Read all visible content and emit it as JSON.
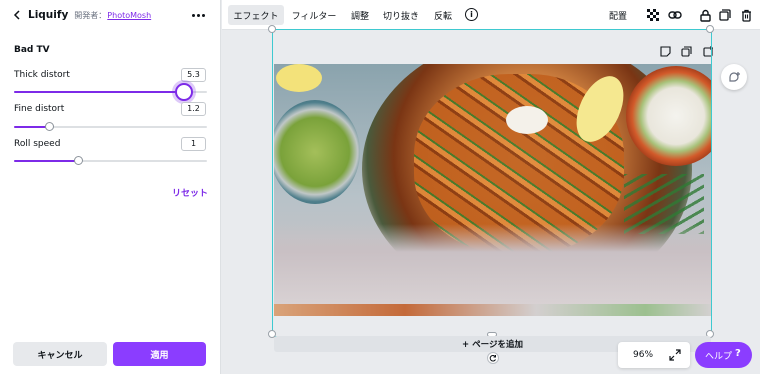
{
  "panel": {
    "title": "Liquify",
    "byline_prefix": "開発者：",
    "byline_author": "PhotoMosh",
    "effect_name": "Bad TV",
    "controls": [
      {
        "label": "Thick distort",
        "value": "5.3",
        "fraction": 0.88
      },
      {
        "label": "Fine distort",
        "value": "1.2",
        "fraction": 0.18
      },
      {
        "label": "Roll speed",
        "value": "1",
        "fraction": 0.33
      }
    ],
    "reset_label": "リセット",
    "cancel_label": "キャンセル",
    "apply_label": "適用"
  },
  "toolbar": {
    "tabs": [
      "エフェクト",
      "フィルター",
      "調整",
      "切り抜き",
      "反転"
    ],
    "info_glyph": "i",
    "arrange_label": "配置",
    "icons": [
      "transparency-icon",
      "link-icon",
      "lock-icon",
      "duplicate-icon",
      "trash-icon"
    ]
  },
  "canvas": {
    "add_page_label": "+ ページを追加",
    "zoom_label": "96%",
    "help_label": "ヘルプ",
    "help_glyph": "?"
  },
  "colors": {
    "accent": "#8b3dff",
    "link": "#7d2ae8",
    "selection": "#3ec9d0"
  }
}
